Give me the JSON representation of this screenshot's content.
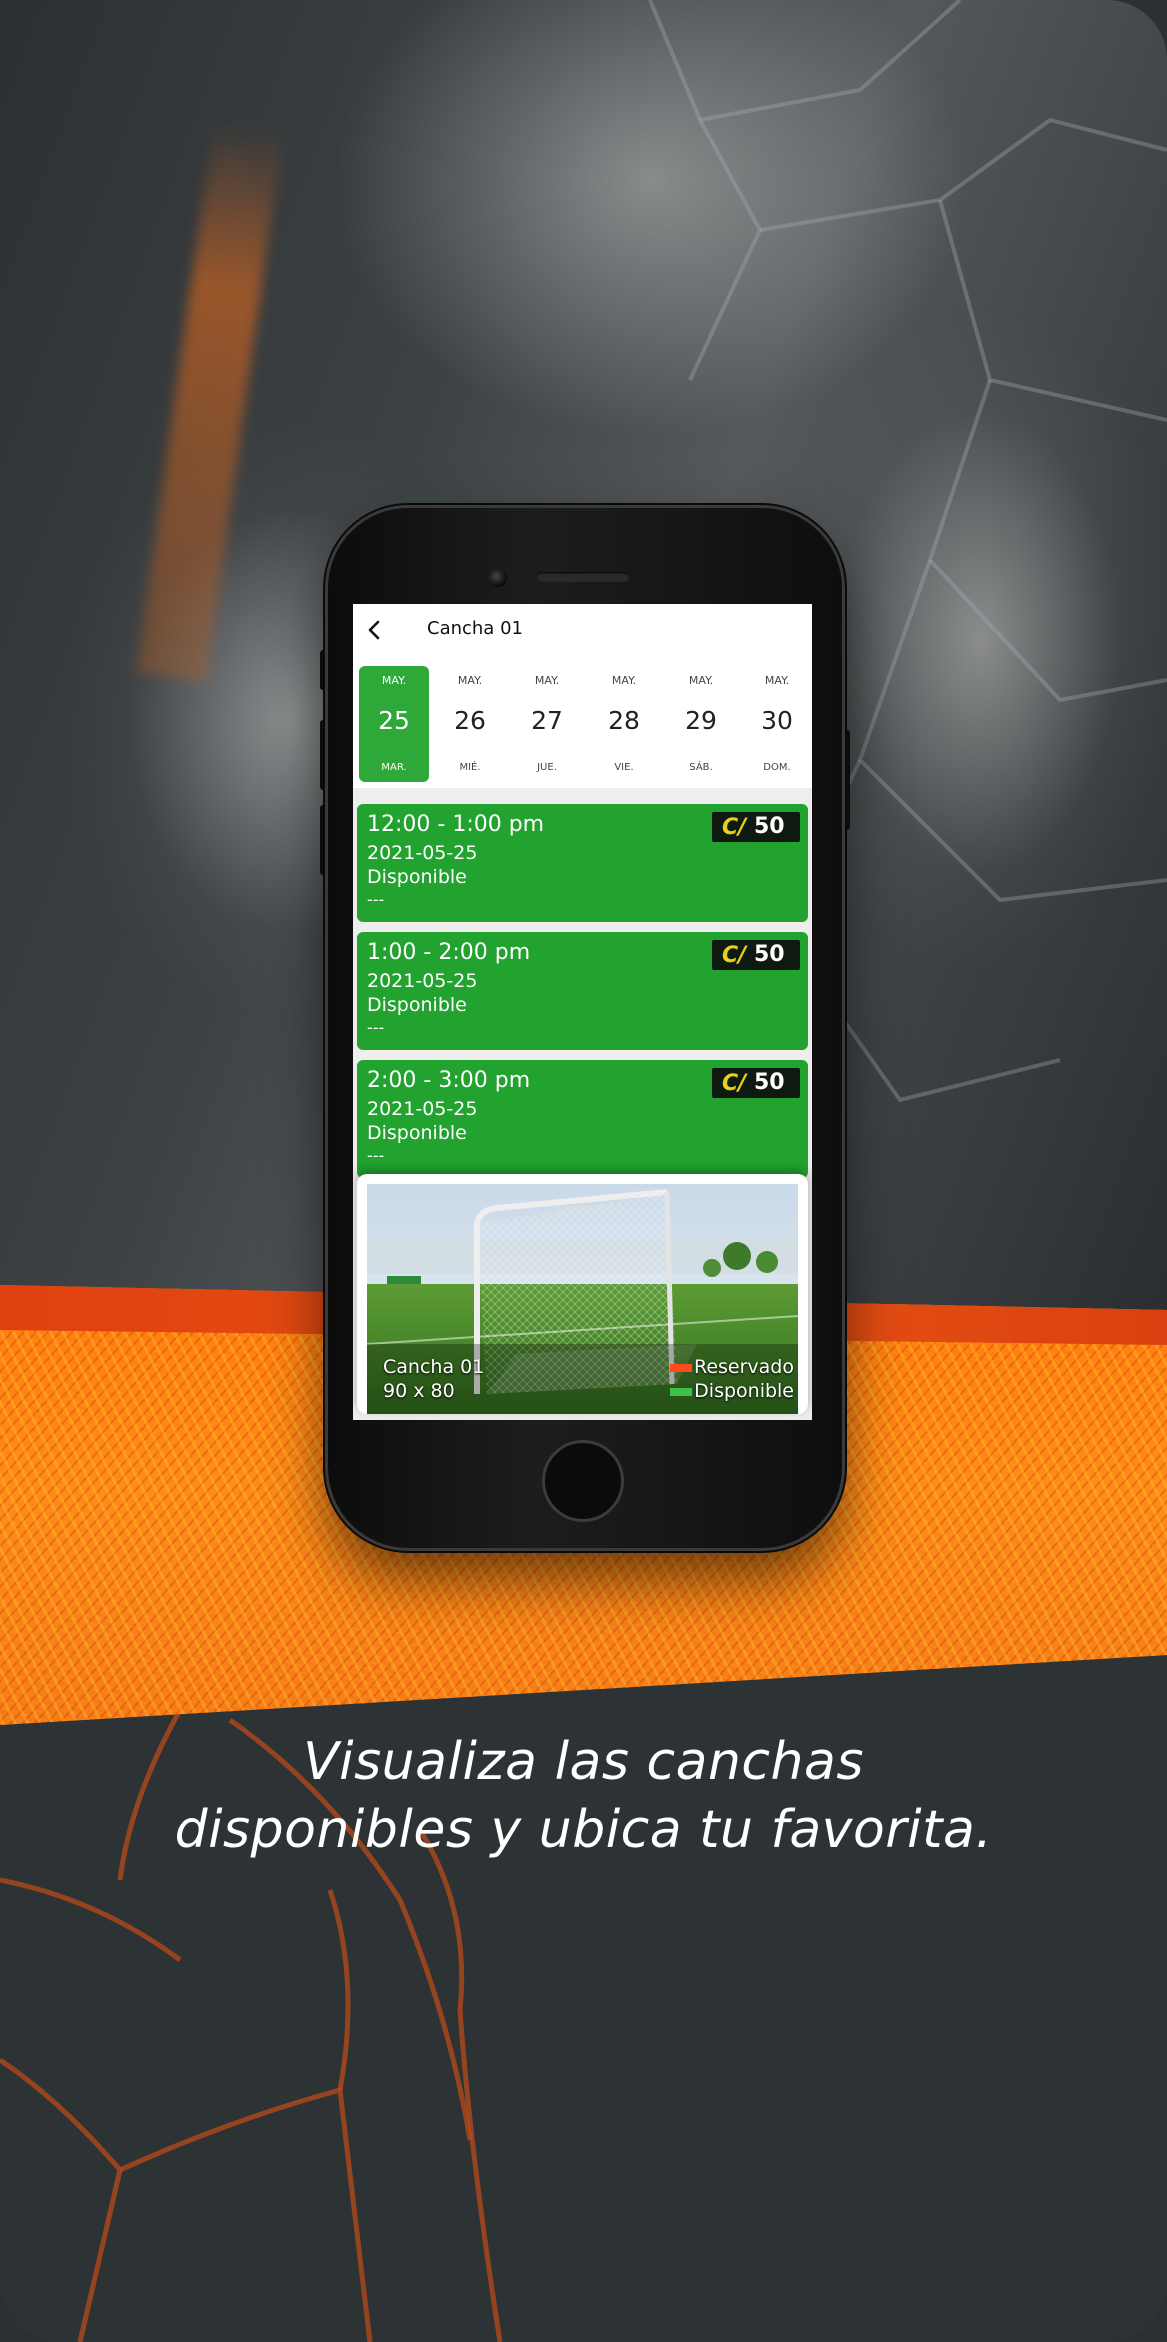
{
  "caption": {
    "line1": "Visualiza las canchas",
    "line2": "disponibles y ubica tu favorita."
  },
  "app": {
    "title": "Cancha 01",
    "back_icon": "chevron-left-icon"
  },
  "dates": [
    {
      "month": "MAY.",
      "day": "25",
      "weekday": "MAR.",
      "selected": true
    },
    {
      "month": "MAY.",
      "day": "26",
      "weekday": "MIÉ.",
      "selected": false
    },
    {
      "month": "MAY.",
      "day": "27",
      "weekday": "JUE.",
      "selected": false
    },
    {
      "month": "MAY.",
      "day": "28",
      "weekday": "VIE.",
      "selected": false
    },
    {
      "month": "MAY.",
      "day": "29",
      "weekday": "SÁB.",
      "selected": false
    },
    {
      "month": "MAY.",
      "day": "30",
      "weekday": "DOM.",
      "selected": false
    }
  ],
  "slots": [
    {
      "time": "12:00 - 1:00 pm",
      "date": "2021-05-25",
      "status": "Disponible",
      "note": "---",
      "currency": "C/",
      "price": "50"
    },
    {
      "time": "1:00 - 2:00 pm",
      "date": "2021-05-25",
      "status": "Disponible",
      "note": "---",
      "currency": "C/",
      "price": "50"
    },
    {
      "time": "2:00 - 3:00 pm",
      "date": "2021-05-25",
      "status": "Disponible",
      "note": "---",
      "currency": "C/",
      "price": "50"
    }
  ],
  "court": {
    "name": "Cancha 01",
    "size": "90 x 80",
    "legend": [
      {
        "label": "Reservado",
        "color": "#ff4a1a"
      },
      {
        "label": "Disponible",
        "color": "#3cc248"
      }
    ]
  },
  "colors": {
    "accent_green": "#22a32f",
    "selected_date": "#2fa83a",
    "price_currency": "#e5d21a",
    "brand_orange": "#ff7a10"
  }
}
